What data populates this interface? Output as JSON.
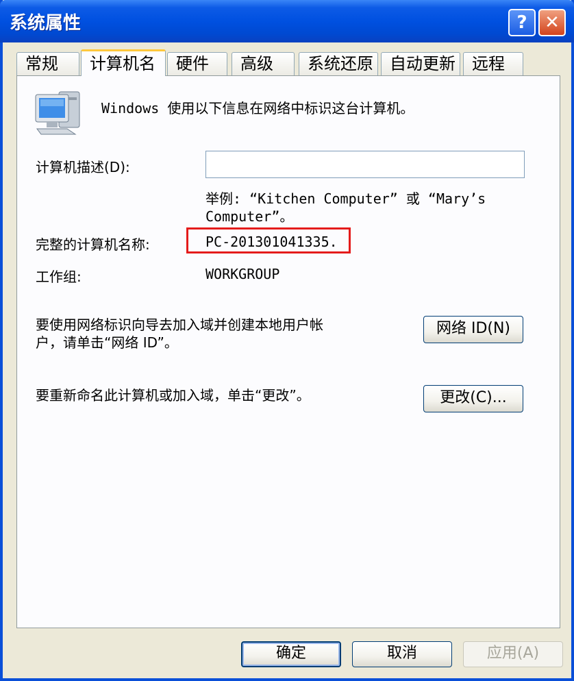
{
  "window": {
    "title": "系统属性",
    "help_label": "?",
    "close_label": "✕"
  },
  "tabs": [
    {
      "label": "常规",
      "active": false
    },
    {
      "label": "计算机名",
      "active": true
    },
    {
      "label": "硬件",
      "active": false
    },
    {
      "label": "高级",
      "active": false
    },
    {
      "label": "系统还原",
      "active": false
    },
    {
      "label": "自动更新",
      "active": false
    },
    {
      "label": "远程",
      "active": false
    }
  ],
  "content": {
    "intro_text": "Windows 使用以下信息在网络中标识这台计算机。",
    "description_label": "计算机描述(D):",
    "description_value": "",
    "example_line1": "举例: “Kitchen Computer” 或 “Mary’s",
    "example_line2": "Computer”。",
    "full_name_label": "完整的计算机名称:",
    "full_name_value": "PC-201301041335.",
    "workgroup_label": "工作组:",
    "workgroup_value": "WORKGROUP",
    "network_id_text_line1": "要使用网络标识向导去加入域并创建本地用户帐",
    "network_id_text_line2": "户，请单击“网络 ID”。",
    "network_id_button": "网络 ID(N)",
    "rename_text": "要重新命名此计算机或加入域，单击“更改”。",
    "change_button": "更改(C)..."
  },
  "footer": {
    "ok_button": "确定",
    "cancel_button": "取消",
    "apply_button": "应用(A)"
  },
  "colors": {
    "titlebar": "#0050e0",
    "dialog_bg": "#ece9d8",
    "highlight_box": "#e41b1b",
    "active_tab_accent": "#ffc83c"
  },
  "icons": [
    "computer-icon",
    "help-icon",
    "close-icon"
  ]
}
